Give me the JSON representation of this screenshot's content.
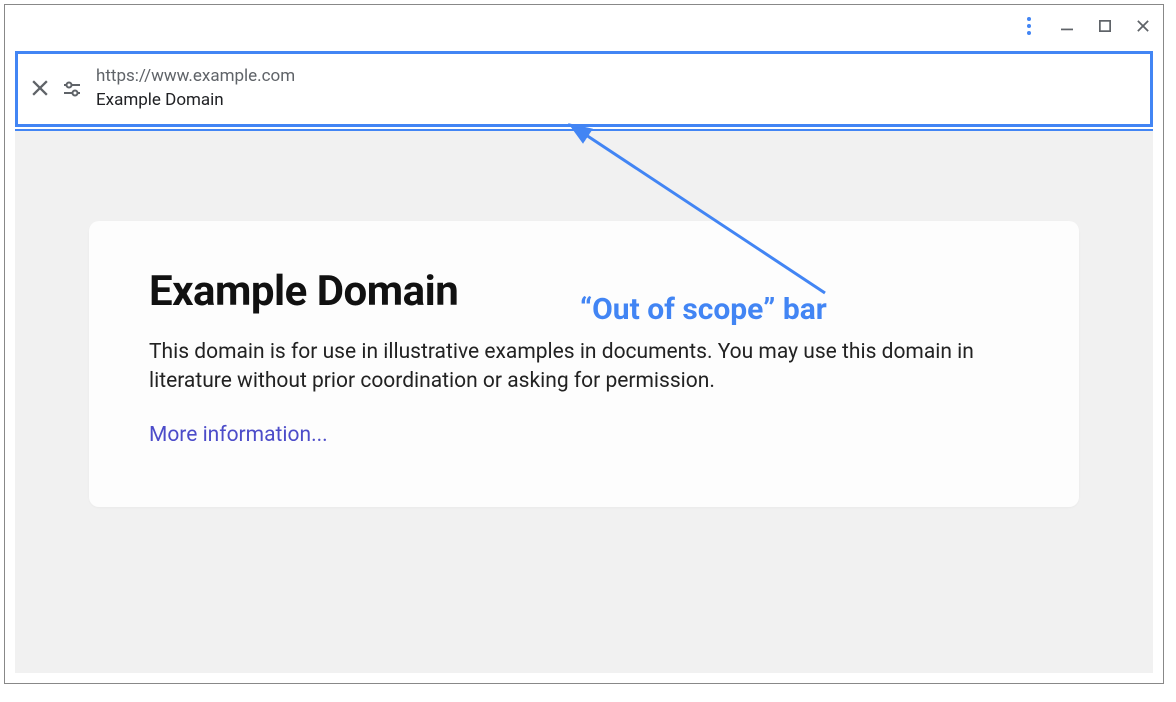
{
  "window": {
    "more_tooltip": "More",
    "minimize_tooltip": "Minimize",
    "maximize_tooltip": "Maximize",
    "close_tooltip": "Close"
  },
  "scope_bar": {
    "close_tooltip": "Close",
    "tune_tooltip": "Tune",
    "url": "https://www.example.com",
    "title": "Example Domain"
  },
  "page": {
    "heading": "Example Domain",
    "body": "This domain is for use in illustrative examples in documents. You may use this domain in literature without prior coordination or asking for permission.",
    "link": "More information..."
  },
  "annotation": {
    "label": "“Out of scope” bar"
  },
  "colors": {
    "accent": "#4285f4",
    "link": "#4c4cc9",
    "gray_bg": "#f1f1f1"
  }
}
